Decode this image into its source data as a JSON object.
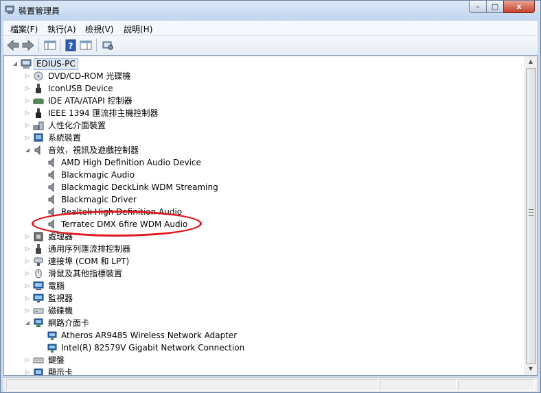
{
  "window": {
    "title": "裝置管理員",
    "controls": {
      "minimize": "–",
      "maximize": "□",
      "close": "x"
    }
  },
  "menu": {
    "items": [
      "檔案(F)",
      "執行(A)",
      "檢視(V)",
      "說明(H)"
    ]
  },
  "toolbar": {
    "buttons": [
      "back-icon",
      "forward-icon",
      "console-tree-icon",
      "help-icon",
      "properties-icon",
      "scan-hardware-icon"
    ]
  },
  "tree": {
    "root": "EDIUS-PC",
    "items": [
      {
        "label": "DVD/CD-ROM 光碟機",
        "level": 1,
        "expander": "collapsed",
        "icon": "dvd-drive-icon"
      },
      {
        "label": "IconUSB Device",
        "level": 1,
        "expander": "collapsed",
        "icon": "usb-device-icon"
      },
      {
        "label": "IDE ATA/ATAPI 控制器",
        "level": 1,
        "expander": "collapsed",
        "icon": "ide-controller-icon"
      },
      {
        "label": "IEEE 1394 匯流排主機控制器",
        "level": 1,
        "expander": "collapsed",
        "icon": "ieee1394-icon"
      },
      {
        "label": "人性化介面裝置",
        "level": 1,
        "expander": "collapsed",
        "icon": "hid-icon"
      },
      {
        "label": "系統裝置",
        "level": 1,
        "expander": "collapsed",
        "icon": "system-device-icon"
      },
      {
        "label": "音效，視訊及遊戲控制器",
        "level": 1,
        "expander": "expanded",
        "icon": "speaker-icon"
      },
      {
        "label": "AMD High Definition Audio Device",
        "level": 2,
        "icon": "speaker-icon"
      },
      {
        "label": "Blackmagic Audio",
        "level": 2,
        "icon": "speaker-icon"
      },
      {
        "label": "Blackmagic DeckLink WDM Streaming",
        "level": 2,
        "icon": "speaker-icon"
      },
      {
        "label": "Blackmagic Driver",
        "level": 2,
        "icon": "speaker-icon"
      },
      {
        "label": "Realtek High Definition Audio",
        "level": 2,
        "icon": "speaker-icon"
      },
      {
        "label": "Terratec DMX 6fire WDM Audio",
        "level": 2,
        "icon": "speaker-icon"
      },
      {
        "label": "處理器",
        "level": 1,
        "expander": "collapsed",
        "icon": "processor-icon"
      },
      {
        "label": "通用序列匯流排控制器",
        "level": 1,
        "expander": "collapsed",
        "icon": "usb-controller-icon"
      },
      {
        "label": "連接埠 (COM 和 LPT)",
        "level": 1,
        "expander": "collapsed",
        "icon": "port-icon"
      },
      {
        "label": "滑鼠及其他指標裝置",
        "level": 1,
        "expander": "collapsed",
        "icon": "mouse-icon"
      },
      {
        "label": "電腦",
        "level": 1,
        "expander": "collapsed",
        "icon": "computer-icon"
      },
      {
        "label": "監視器",
        "level": 1,
        "expander": "collapsed",
        "icon": "monitor-icon"
      },
      {
        "label": "磁碟機",
        "level": 1,
        "expander": "collapsed",
        "icon": "disk-drive-icon"
      },
      {
        "label": "網路介面卡",
        "level": 1,
        "expander": "expanded",
        "icon": "network-icon"
      },
      {
        "label": "Atheros AR9485 Wireless Network Adapter",
        "level": 2,
        "icon": "network-adapter-icon"
      },
      {
        "label": "Intel(R) 82579V Gigabit Network Connection",
        "level": 2,
        "icon": "network-adapter-icon"
      },
      {
        "label": "鍵盤",
        "level": 1,
        "expander": "collapsed",
        "icon": "keyboard-icon"
      },
      {
        "label": "顯示卡",
        "level": 1,
        "expander": "collapsed",
        "icon": "display-adapter-icon"
      }
    ]
  },
  "colors": {
    "highlight_ellipse": "#e0141c",
    "window_frame": "#c9daf0",
    "selection": "#dfe9f6"
  }
}
